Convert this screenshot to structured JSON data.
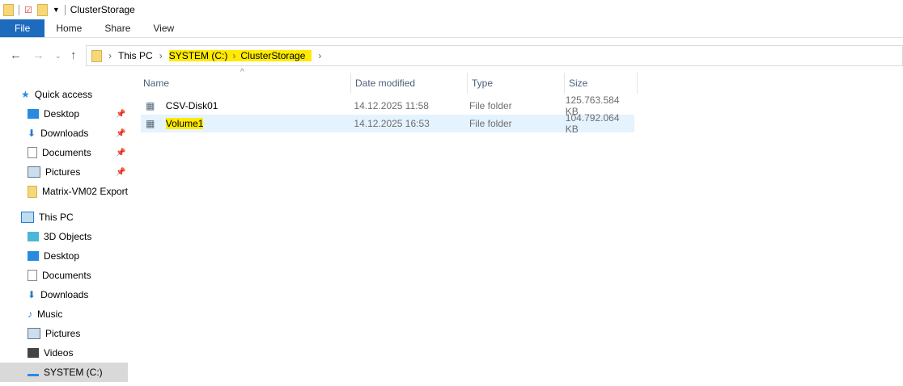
{
  "window": {
    "title": "ClusterStorage"
  },
  "ribbon": {
    "tabs": [
      "File",
      "Home",
      "Share",
      "View"
    ]
  },
  "address": {
    "segments": [
      "This PC",
      "SYSTEM (C:)",
      "ClusterStorage"
    ]
  },
  "columns": [
    "Name",
    "Date modified",
    "Type",
    "Size"
  ],
  "files": [
    {
      "name": "CSV-Disk01",
      "date": "14.12.2025 11:58",
      "type": "File folder",
      "size": "125.763.584 KB"
    },
    {
      "name": "Volume1",
      "date": "14.12.2025 16:53",
      "type": "File folder",
      "size": "104.792.064 KB"
    }
  ],
  "sidebar": {
    "quick_access": "Quick access",
    "quick": [
      "Desktop",
      "Downloads",
      "Documents",
      "Pictures",
      "Matrix-VM02 Export"
    ],
    "this_pc": "This PC",
    "pc": [
      "3D Objects",
      "Desktop",
      "Documents",
      "Downloads",
      "Music",
      "Pictures",
      "Videos",
      "SYSTEM (C:)"
    ]
  }
}
